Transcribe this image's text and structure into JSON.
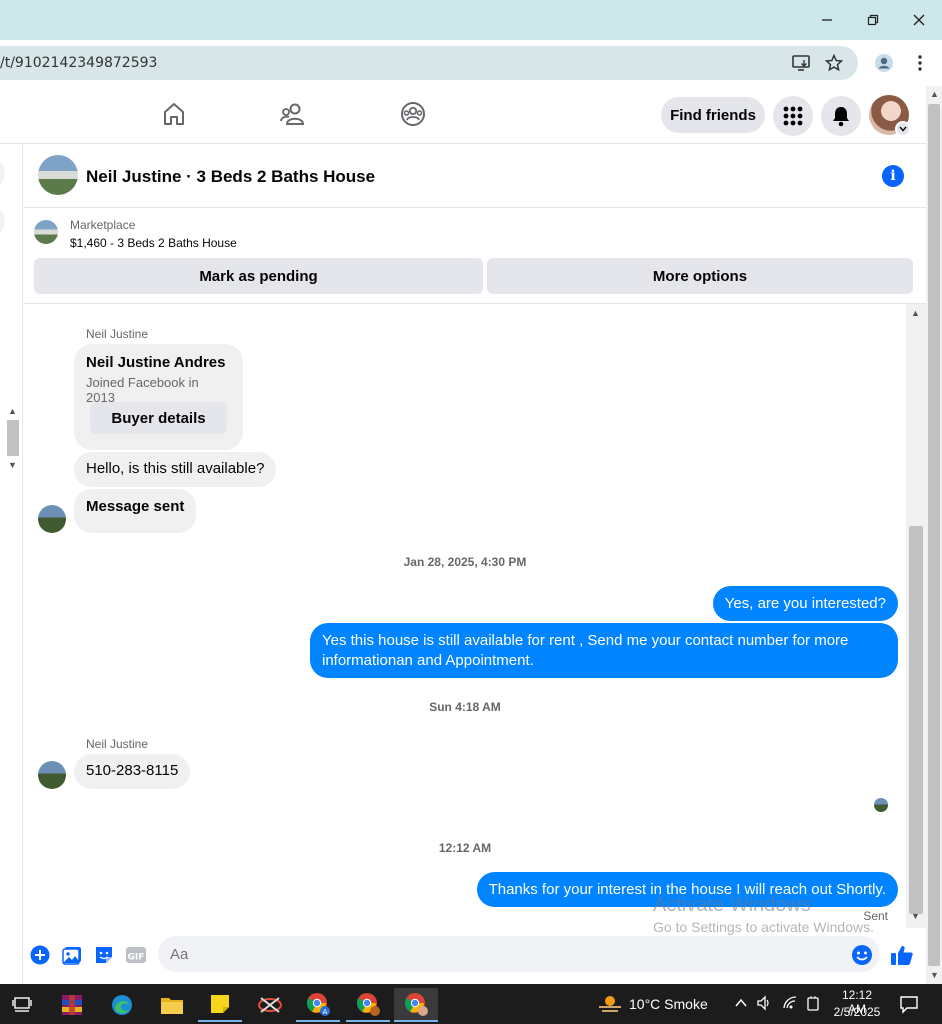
{
  "browser": {
    "url": "/t/9102142349872593"
  },
  "fbnav": {
    "find_friends": "Find friends"
  },
  "conversation": {
    "title": "Neil Justine · 3 Beds 2 Baths House",
    "marketplace_label": "Marketplace",
    "listing": "$1,460 - 3 Beds 2 Baths House",
    "mark_pending": "Mark as pending",
    "more_options": "More options"
  },
  "messages": {
    "sender_name_1": "Neil Justine",
    "profile_name": "Neil Justine Andres",
    "profile_joined": "Joined Facebook in 2013",
    "buyer_details": "Buyer details",
    "msg_available": "Hello, is this still available?",
    "msg_sent_note": "Message sent",
    "time_1": "Jan 28, 2025, 4:30 PM",
    "out_1": "Yes, are you interested?",
    "out_2": "Yes this house is still available for rent , Send me your contact number for more informationan and Appointment.",
    "time_2": "Sun 4:18 AM",
    "sender_name_2": "Neil Justine",
    "in_phone": "510-283-8115",
    "time_3": "12:12 AM",
    "out_3": "Thanks for your interest in the house I will reach out Shortly.",
    "status": "Sent"
  },
  "composer": {
    "placeholder": "Aa"
  },
  "watermark": {
    "line1": "Activate Windows",
    "line2": "Go to Settings to activate Windows."
  },
  "taskbar": {
    "weather": "10°C  Smoke",
    "time": "12:12 AM",
    "date": "2/5/2025"
  },
  "colors": {
    "accent": "#0866ff",
    "outgoing_bubble": "#0084ff",
    "incoming_bubble": "#f0f0f0"
  }
}
